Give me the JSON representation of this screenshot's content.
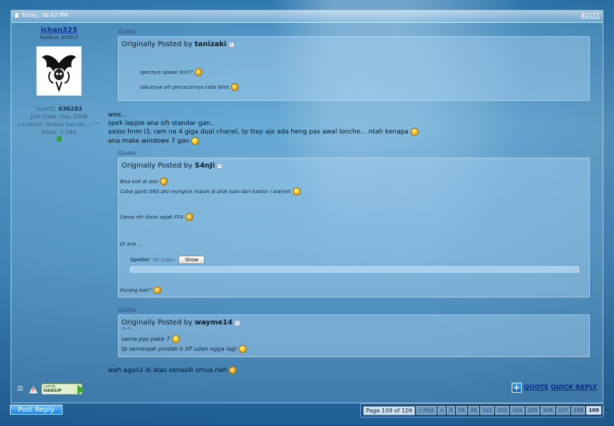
{
  "post": {
    "date": "Today, 06:42 PM",
    "number": "#2172"
  },
  "user": {
    "name": "ichan323",
    "title": "kaskus addict",
    "userid_label": "UserID:",
    "userid": "636283",
    "join_date": "Join Date: Dec 2008",
    "location": "Location: tarima barcen...^^",
    "posts": "Posts: 2,563"
  },
  "quote1": {
    "label": "Quote:",
    "posted_by": "Originally Posted by",
    "author": "tanizaki",
    "lines": [
      "specnya opaan bro??",
      "takutnya sih procecornya rada lelet"
    ]
  },
  "body1": [
    "wee...",
    "spek lappie ana sih standar gan..",
    "axioo hnm i3, ram na 4 giga dual chanel, tp ttep aje ada heng pas awal lonche... ntah kenapa",
    "ana make windows 7 gan"
  ],
  "quote2": {
    "label": "Quote:",
    "posted_by": "Originally Posted by",
    "author": "S4nJi",
    "lines": [
      "Bisa kok di ane",
      "Coba ganti DNS ato mungkin malah di blok kalo dari kantor / warnet",
      "Sama nih disini sejak FF4",
      "Di ane ...",
      "Kurang kah?"
    ],
    "spoiler_label": "Spoiler",
    "spoiler_for": "for Cupu:",
    "show_button": "Show"
  },
  "quote3": {
    "label": "Quote:",
    "posted_by": "Originally Posted by",
    "author": "wayme14",
    "lines": [
      "^^",
      "sama pas pake 7",
      "tp semenjak pindah k XP udah ngga lagi"
    ]
  },
  "body2": "wah agan2 di atas senasib smua neh",
  "footer": {
    "lapor_small": "LAPOR",
    "lapor_big": "HANSIP",
    "quote_link": "QUOTE",
    "quick_reply": "QUICK REPLY",
    "post_reply": "Post Reply"
  },
  "pagination": {
    "label": "Page 109 of 109",
    "first": "« First",
    "pages": [
      "<",
      "9",
      "59",
      "99",
      "102",
      "103",
      "104",
      "105",
      "106",
      "107",
      "108",
      "109"
    ],
    "current": "109"
  },
  "icons": {
    "avatar": "winged-skull-avatar",
    "scale": "scale-icon",
    "warning": "warning-icon",
    "smiley": "smiley-icon",
    "plus": "plus-icon"
  }
}
